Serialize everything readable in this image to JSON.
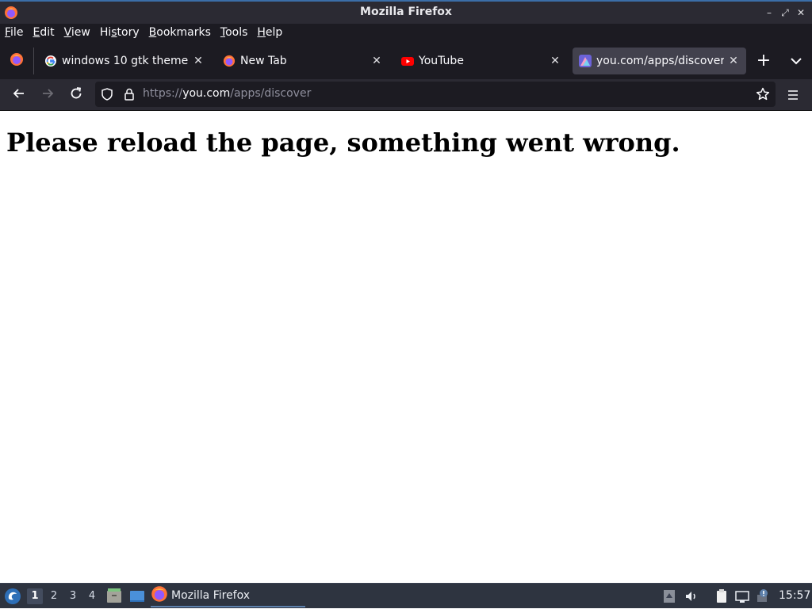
{
  "window": {
    "title": "Mozilla Firefox",
    "controls": {
      "minimize": "–",
      "restore": "⤢",
      "close": "✕"
    }
  },
  "menubar": {
    "items": [
      {
        "label_mnemonic": "F",
        "label_rest": "ile"
      },
      {
        "label_mnemonic": "E",
        "label_rest": "dit"
      },
      {
        "label_mnemonic": "V",
        "label_rest": "iew"
      },
      {
        "label_pre": "Hi",
        "label_mnemonic": "s",
        "label_rest": "tory"
      },
      {
        "label_mnemonic": "B",
        "label_rest": "ookmarks"
      },
      {
        "label_mnemonic": "T",
        "label_rest": "ools"
      },
      {
        "label_mnemonic": "H",
        "label_rest": "elp"
      }
    ]
  },
  "tabs": [
    {
      "label": "windows 10 gtk theme - ",
      "icon": "google-icon",
      "active": false
    },
    {
      "label": "New Tab",
      "icon": "firefox-icon",
      "active": false
    },
    {
      "label": "YouTube",
      "icon": "youtube-icon",
      "active": false
    },
    {
      "label": "you.com/apps/discover",
      "icon": "you-com-icon",
      "active": true
    }
  ],
  "tab_close_glyph": "✕",
  "new_tab_glyph": "+",
  "urlbar": {
    "scheme": "https://",
    "domain": "you.com",
    "path": "/apps/discover"
  },
  "page": {
    "heading": "Please reload the page, something went wrong."
  },
  "taskbar": {
    "workspaces": [
      "1",
      "2",
      "3",
      "4"
    ],
    "current_workspace": "1",
    "task_label": "Mozilla Firefox",
    "clock": "15:57"
  },
  "colors": {
    "accent": "#3b6ea8",
    "toolbar": "#2b2a33",
    "tabstrip": "#1c1b22",
    "active_tab": "#42414d",
    "taskbar": "#2e3440"
  }
}
